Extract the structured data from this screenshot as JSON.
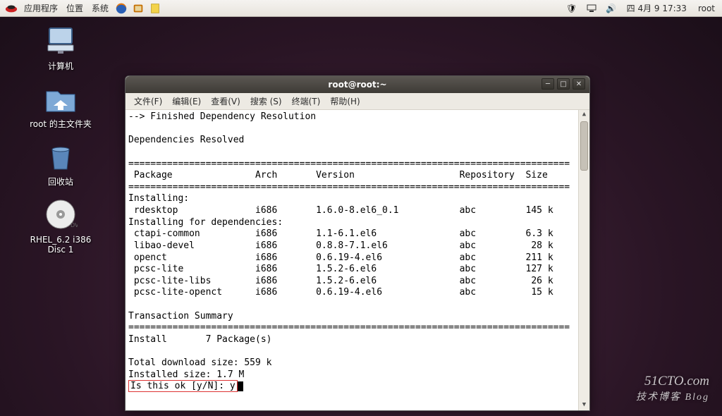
{
  "panel": {
    "apps": "应用程序",
    "places": "位置",
    "system": "系统",
    "clock": "四 4月  9 17:33",
    "user": "root"
  },
  "desktop": {
    "computer": "计算机",
    "home": "root 的主文件夹",
    "trash": "回收站",
    "disc": "RHEL_6.2 i386 Disc 1"
  },
  "window": {
    "title": "root@root:~",
    "menus": {
      "file": "文件(F)",
      "edit": "编辑(E)",
      "view": "查看(V)",
      "search": "搜索 (S)",
      "terminal": "终端(T)",
      "help": "帮助(H)"
    }
  },
  "terminal": {
    "line_finished": "--> Finished Dependency Resolution",
    "deps_resolved": "Dependencies Resolved",
    "header_package": "Package",
    "header_arch": "Arch",
    "header_version": "Version",
    "header_repo": "Repository",
    "header_size": "Size",
    "installing": "Installing:",
    "installing_deps": "Installing for dependencies:",
    "packages": [
      {
        "name": "rdesktop",
        "arch": "i686",
        "version": "1.6.0-8.el6_0.1",
        "repo": "abc",
        "size": "145 k"
      },
      {
        "name": "ctapi-common",
        "arch": "i686",
        "version": "1.1-6.1.el6",
        "repo": "abc",
        "size": "6.3 k"
      },
      {
        "name": "libao-devel",
        "arch": "i686",
        "version": "0.8.8-7.1.el6",
        "repo": "abc",
        "size": " 28 k"
      },
      {
        "name": "openct",
        "arch": "i686",
        "version": "0.6.19-4.el6",
        "repo": "abc",
        "size": "211 k"
      },
      {
        "name": "pcsc-lite",
        "arch": "i686",
        "version": "1.5.2-6.el6",
        "repo": "abc",
        "size": "127 k"
      },
      {
        "name": "pcsc-lite-libs",
        "arch": "i686",
        "version": "1.5.2-6.el6",
        "repo": "abc",
        "size": " 26 k"
      },
      {
        "name": "pcsc-lite-openct",
        "arch": "i686",
        "version": "0.6.19-4.el6",
        "repo": "abc",
        "size": " 15 k"
      }
    ],
    "txn_summary": "Transaction Summary",
    "install_count": "Install       7 Package(s)",
    "total_dl": "Total download size: 559 k",
    "installed_size": "Installed size: 1.7 M",
    "prompt": "Is this ok [y/N]: y"
  },
  "watermark": {
    "main": "51CTO.com",
    "sub": "技术博客   Blog"
  }
}
